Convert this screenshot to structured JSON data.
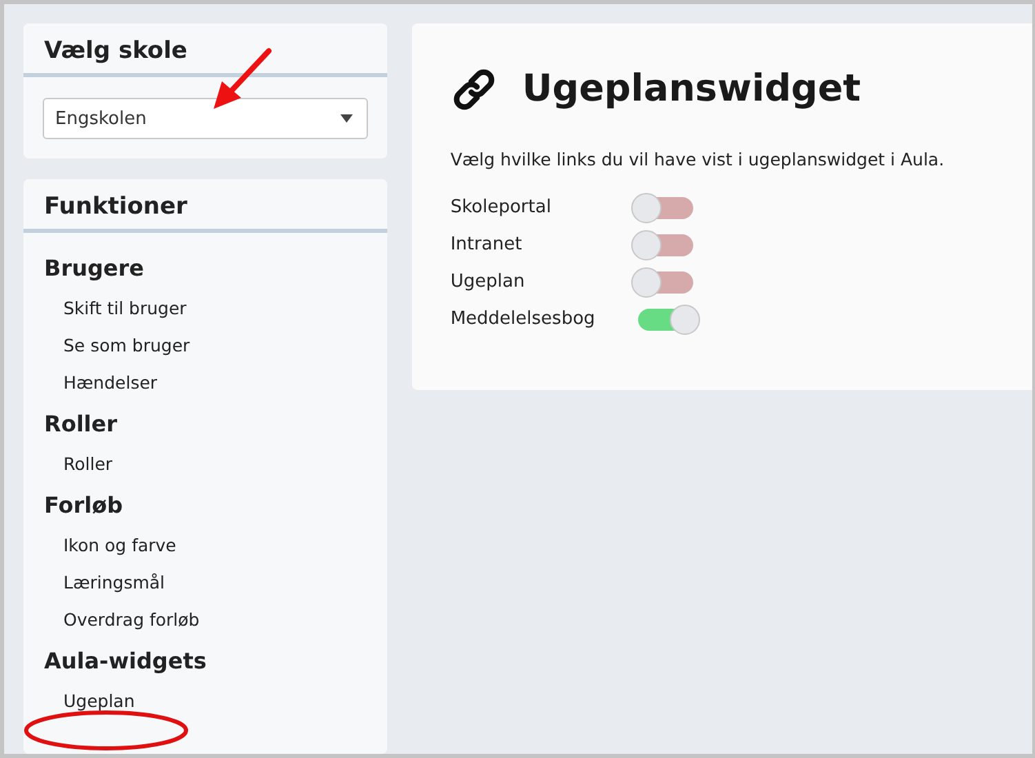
{
  "school_select": {
    "title": "Vælg skole",
    "value": "Engskolen"
  },
  "functions": {
    "title": "Funktioner",
    "groups": [
      {
        "heading": "Brugere",
        "items": [
          {
            "label": "Skift til bruger"
          },
          {
            "label": "Se som bruger"
          },
          {
            "label": "Hændelser"
          }
        ]
      },
      {
        "heading": "Roller",
        "items": [
          {
            "label": "Roller"
          }
        ]
      },
      {
        "heading": "Forløb",
        "items": [
          {
            "label": "Ikon og farve"
          },
          {
            "label": "Læringsmål"
          },
          {
            "label": "Overdrag forløb"
          }
        ]
      },
      {
        "heading": "Aula-widgets",
        "items": [
          {
            "label": "Ugeplan"
          }
        ]
      }
    ]
  },
  "widget": {
    "title": "Ugeplanswidget",
    "description": "Vælg hvilke links du vil have vist i ugeplanswidget i Aula.",
    "links": [
      {
        "label": "Skoleportal",
        "on": false
      },
      {
        "label": "Intranet",
        "on": false
      },
      {
        "label": "Ugeplan",
        "on": false
      },
      {
        "label": "Meddelelsesbog",
        "on": true
      }
    ]
  }
}
